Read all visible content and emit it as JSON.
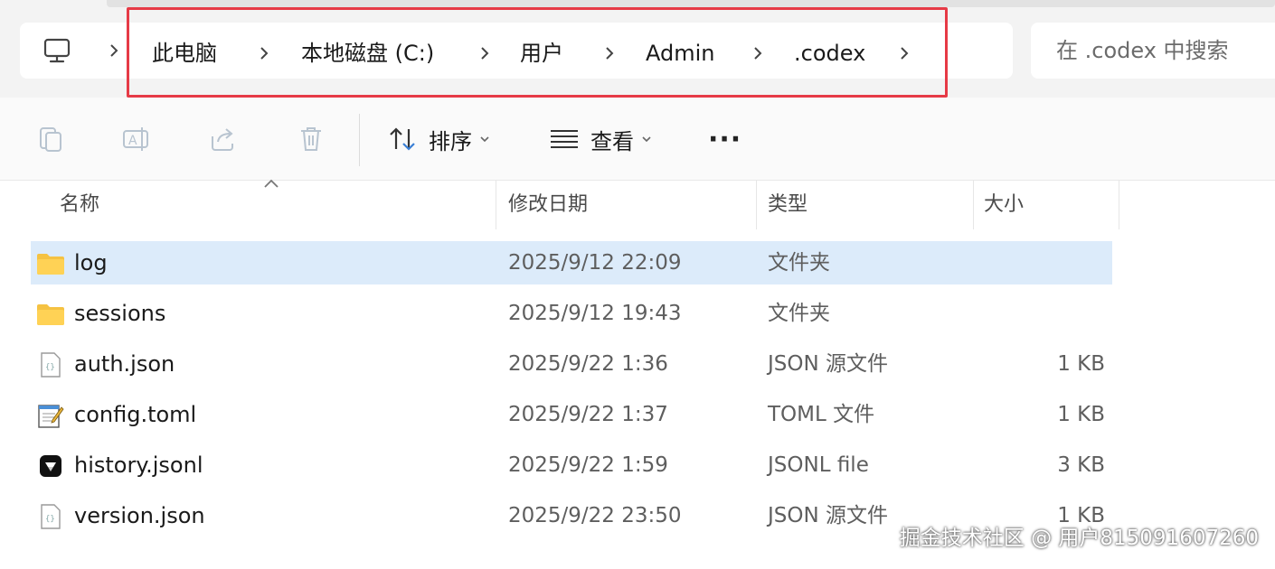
{
  "breadcrumb": {
    "root_icon": "computer-icon",
    "items": [
      "此电脑",
      "本地磁盘 (C:)",
      "用户",
      "Admin",
      ".codex"
    ]
  },
  "search": {
    "placeholder": "在 .codex 中搜索"
  },
  "toolbar": {
    "copy_icon": "copy-icon",
    "rename_icon": "rename-icon",
    "share_icon": "share-icon",
    "delete_icon": "delete-icon",
    "sort_label": "排序",
    "view_label": "查看",
    "more_label": "···"
  },
  "columns": {
    "name": "名称",
    "modified": "修改日期",
    "type": "类型",
    "size": "大小"
  },
  "files": [
    {
      "name": "log",
      "modified": "2025/9/12 22:09",
      "type": "文件夹",
      "size": "",
      "icon": "folder-icon",
      "selected": true
    },
    {
      "name": "sessions",
      "modified": "2025/9/12 19:43",
      "type": "文件夹",
      "size": "",
      "icon": "folder-icon",
      "selected": false
    },
    {
      "name": "auth.json",
      "modified": "2025/9/22 1:36",
      "type": "JSON 源文件",
      "size": "1 KB",
      "icon": "json-file-icon",
      "selected": false
    },
    {
      "name": "config.toml",
      "modified": "2025/9/22 1:37",
      "type": "TOML 文件",
      "size": "1 KB",
      "icon": "notepad-file-icon",
      "selected": false
    },
    {
      "name": "history.jsonl",
      "modified": "2025/9/22 1:59",
      "type": "JSONL file",
      "size": "3 KB",
      "icon": "app-file-icon",
      "selected": false
    },
    {
      "name": "version.json",
      "modified": "2025/9/22 23:50",
      "type": "JSON 源文件",
      "size": "1 KB",
      "icon": "json-file-icon",
      "selected": false
    }
  ],
  "watermark": "掘金技术社区 @ 用户815091607260",
  "colors": {
    "selection": "#dcebfa",
    "highlight_border": "#e63a46",
    "folder": "#f5c242"
  }
}
